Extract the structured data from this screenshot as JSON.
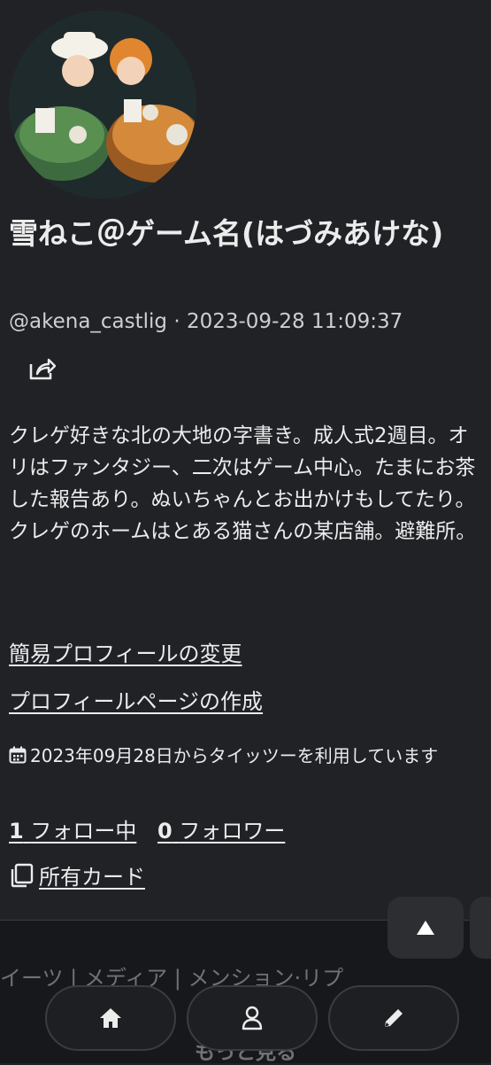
{
  "profile": {
    "display_name": "雪ねこ＠ゲーム名(はづみあけな)",
    "meta": "@akena_castlig · 2023-09-28 11:09:37",
    "bio": "クレゲ好きな北の大地の字書き。成人式2週目。オリはファンタジー、二次はゲーム中心。たまにお茶した報告あり。ぬいちゃんとお出かけもしてたり。クレゲのホームはとある猫さんの某店舗。避難所。",
    "links": {
      "edit_simple_profile": "簡易プロフィールの変更",
      "create_profile_page": "プロフィールページの作成"
    },
    "joined": "2023年09月28日からタイッツーを利用しています",
    "following_count": "1",
    "following_label": "フォロー中",
    "followers_count": "0",
    "followers_label": "フォロワー",
    "cards_label": "所有カード"
  },
  "tabs_text": "イーツ | メディア | メンション·リプ",
  "more_label": "もっと見る",
  "icons": {
    "share": "share-icon",
    "calendar": "calendar-icon",
    "cards": "cards-icon",
    "scroll_top": "arrow-up-icon",
    "home": "home-icon",
    "profile": "user-icon",
    "compose": "pencil-icon"
  },
  "colors": {
    "background": "#202226",
    "text": "#ECECEC",
    "muted": "#6f7278"
  }
}
